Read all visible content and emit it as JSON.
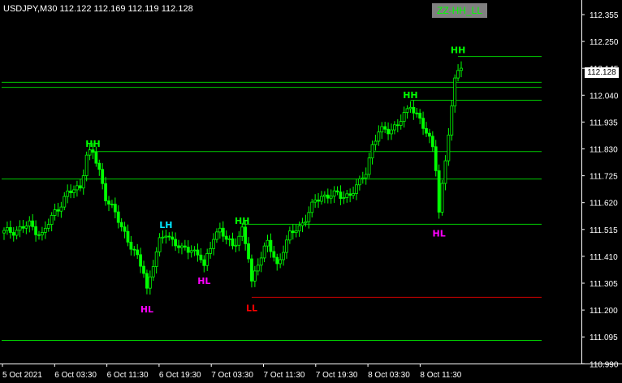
{
  "header": {
    "symbol_timeframe": "USDJPY,M30",
    "ohlc": [
      "112.122",
      "112.169",
      "112.119",
      "112.128"
    ]
  },
  "indicator_label": "ZZ-HH_LL",
  "current_price": "112.128",
  "colors": {
    "background": "#000000",
    "candle": "#00ff00",
    "level_line": "#00cc00",
    "ll_line": "#cc0000",
    "hh_label": "#00ff00",
    "lh_label": "#00e5ff",
    "hl_label": "#ff00ff",
    "ll_label": "#ff0000",
    "axis": "#ffffff"
  },
  "chart_data": {
    "type": "candlestick",
    "y_ticks": [
      "112.355",
      "112.250",
      "112.145",
      "112.040",
      "111.935",
      "111.830",
      "111.725",
      "111.620",
      "111.515",
      "111.410",
      "111.305",
      "111.200",
      "111.095",
      "110.990"
    ],
    "x_ticks": [
      "5 Oct 2021",
      "6 Oct 03:30",
      "6 Oct 11:30",
      "6 Oct 19:30",
      "7 Oct 03:30",
      "7 Oct 11:30",
      "7 Oct 19:30",
      "8 Oct 03:30",
      "8 Oct 11:30"
    ],
    "ylim": [
      110.97,
      112.385
    ],
    "swing_labels": [
      {
        "text": "HH",
        "kind": "hh",
        "bar": 28,
        "price": 111.8
      },
      {
        "text": "HL",
        "kind": "hl",
        "bar": 45,
        "price": 111.22
      },
      {
        "text": "LH",
        "kind": "lh",
        "bar": 51,
        "price": 111.485
      },
      {
        "text": "HL",
        "kind": "hl",
        "bar": 63,
        "price": 111.33
      },
      {
        "text": "HH",
        "kind": "hh",
        "bar": 75,
        "price": 111.5
      },
      {
        "text": "LL",
        "kind": "ll",
        "bar": 78,
        "price": 111.225
      },
      {
        "text": "HH",
        "kind": "hh",
        "bar": 128,
        "price": 111.99
      },
      {
        "text": "HL",
        "kind": "hl",
        "bar": 137,
        "price": 111.515
      },
      {
        "text": "HH",
        "kind": "hh",
        "bar": 143,
        "price": 112.165
      }
    ],
    "levels": [
      {
        "price": 112.165,
        "from_bar": 143,
        "color": "level"
      },
      {
        "price": 112.065,
        "from_bar": 0,
        "color": "level"
      },
      {
        "price": 112.045,
        "from_bar": 0,
        "color": "level"
      },
      {
        "price": 111.995,
        "from_bar": 128,
        "color": "level"
      },
      {
        "price": 111.795,
        "from_bar": 28,
        "color": "level"
      },
      {
        "price": 111.688,
        "from_bar": 0,
        "color": "level"
      },
      {
        "price": 111.512,
        "from_bar": 75,
        "color": "level"
      },
      {
        "price": 111.228,
        "from_bar": 78,
        "color": "ll"
      },
      {
        "price": 111.06,
        "from_bar": 0,
        "color": "level"
      }
    ],
    "close_path": [
      [
        0,
        111.48
      ],
      [
        4,
        111.49
      ],
      [
        8,
        111.51
      ],
      [
        12,
        111.47
      ],
      [
        16,
        111.56
      ],
      [
        20,
        111.63
      ],
      [
        24,
        111.66
      ],
      [
        26,
        111.78
      ],
      [
        28,
        111.79
      ],
      [
        30,
        111.72
      ],
      [
        32,
        111.62
      ],
      [
        35,
        111.55
      ],
      [
        38,
        111.48
      ],
      [
        41,
        111.4
      ],
      [
        44,
        111.33
      ],
      [
        45,
        111.26
      ],
      [
        47,
        111.36
      ],
      [
        49,
        111.44
      ],
      [
        51,
        111.48
      ],
      [
        53,
        111.45
      ],
      [
        56,
        111.41
      ],
      [
        59,
        111.42
      ],
      [
        62,
        111.38
      ],
      [
        63,
        111.34
      ],
      [
        66,
        111.47
      ],
      [
        68,
        111.49
      ],
      [
        70,
        111.45
      ],
      [
        72,
        111.43
      ],
      [
        75,
        111.49
      ],
      [
        77,
        111.38
      ],
      [
        78,
        111.28
      ],
      [
        80,
        111.37
      ],
      [
        83,
        111.44
      ],
      [
        86,
        111.35
      ],
      [
        88,
        111.42
      ],
      [
        90,
        111.47
      ],
      [
        93,
        111.5
      ],
      [
        96,
        111.56
      ],
      [
        98,
        111.6
      ],
      [
        100,
        111.62
      ],
      [
        103,
        111.63
      ],
      [
        106,
        111.62
      ],
      [
        109,
        111.63
      ],
      [
        112,
        111.67
      ],
      [
        114,
        111.72
      ],
      [
        116,
        111.82
      ],
      [
        118,
        111.87
      ],
      [
        121,
        111.88
      ],
      [
        124,
        111.9
      ],
      [
        127,
        111.95
      ],
      [
        128,
        111.98
      ],
      [
        131,
        111.92
      ],
      [
        133,
        111.86
      ],
      [
        135,
        111.82
      ],
      [
        136,
        111.74
      ],
      [
        137,
        111.56
      ],
      [
        139,
        111.76
      ],
      [
        141,
        111.96
      ],
      [
        142,
        112.08
      ],
      [
        143,
        112.13
      ],
      [
        144,
        112.128
      ]
    ],
    "bar_count": 145
  }
}
